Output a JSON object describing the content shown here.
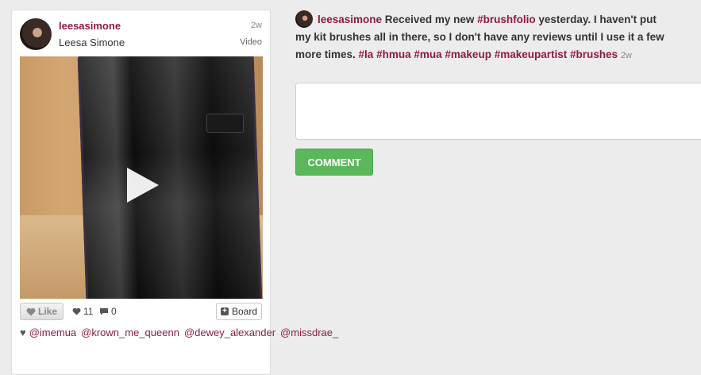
{
  "post": {
    "username": "leesasimone",
    "full_name": "Leesa Simone",
    "time_ago": "2w",
    "media_type": "Video",
    "actions": {
      "like_label": "Like",
      "like_count": "11",
      "comment_count": "0",
      "board_label": "Board"
    },
    "likers": [
      "@imemua",
      "@krown_me_queenn",
      "@dewey_alexander",
      "@missdrae_"
    ]
  },
  "caption": {
    "username": "leesasimone",
    "text_1": " Received my new ",
    "tag_1": "#brushfolio",
    "text_2": " yesterday. I haven't put my kit brushes all in there, so I don't have any reviews until I use it a few more times. ",
    "tags": [
      "#la",
      "#hmua",
      "#mua",
      "#makeup",
      "#makeupartist",
      "#brushes"
    ],
    "time_ago": "2w"
  },
  "comment": {
    "placeholder": "",
    "button_label": "COMMENT"
  },
  "colors": {
    "link": "#8e1b3d",
    "button_green": "#5bb75b",
    "background": "#ececec"
  },
  "icons": {
    "heart": "heart-icon",
    "comment": "comment-bubble-icon",
    "plus": "plus-box-icon",
    "play": "play-icon"
  }
}
